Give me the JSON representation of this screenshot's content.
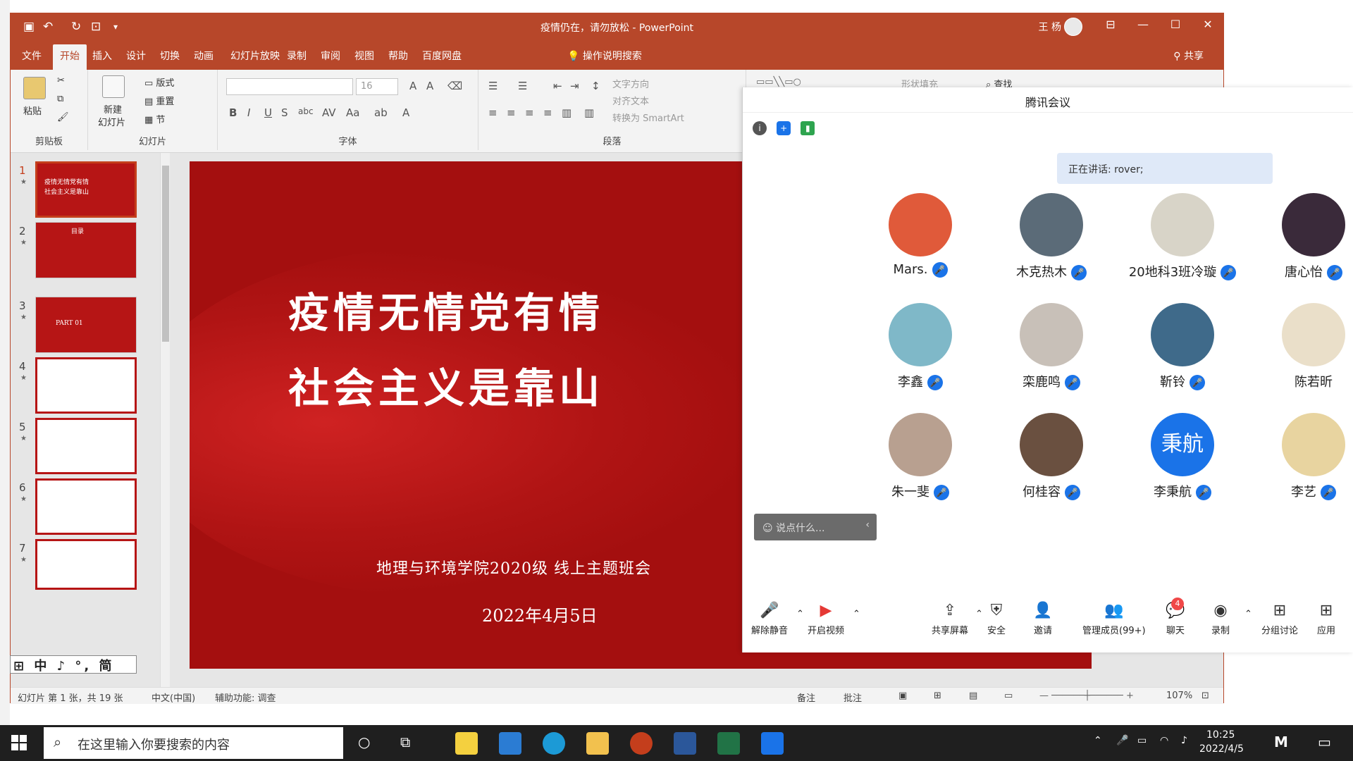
{
  "ppt": {
    "window_title": "疫情仍在，请勿放松  -  PowerPoint",
    "user_name": "王 杨",
    "menus": [
      "文件",
      "开始",
      "插入",
      "设计",
      "切换",
      "动画",
      "幻灯片放映",
      "录制",
      "审阅",
      "视图",
      "帮助",
      "百度网盘"
    ],
    "active_menu": "开始",
    "tell_me": "操作说明搜索",
    "share": "共享",
    "ribbon": {
      "paste": "粘贴",
      "clipboard": "剪贴板",
      "new_slide_1": "新建",
      "new_slide_2": "幻灯片",
      "layout": "版式",
      "reset": "重置",
      "section": "节",
      "slides_group": "幻灯片",
      "font_size": "16",
      "font_group": "字体",
      "paragraph_group": "段落",
      "text_direction": "文字方向",
      "align_text": "对齐文本",
      "smartart": "转换为 SmartArt",
      "shape_fill": "形状填充",
      "find": "查找"
    },
    "thumbnails": [
      {
        "num": "1",
        "text": "疫情无情党有情\n社会主义是靠山"
      },
      {
        "num": "2",
        "text": "目录"
      },
      {
        "num": "3",
        "text": "PART 01"
      },
      {
        "num": "4",
        "text": ""
      },
      {
        "num": "5",
        "text": ""
      },
      {
        "num": "6",
        "text": ""
      },
      {
        "num": "7",
        "text": ""
      }
    ],
    "slide": {
      "title1": "疫情无情党有情",
      "title2": "社会主义是靠山",
      "subtitle": "地理与环境学院2020级 线上主题班会",
      "date": "2022年4月5日"
    },
    "status": {
      "slide_count": "幻灯片 第 1 张，共 19 张",
      "language": "中文(中国)",
      "accessibility": "辅助功能: 调查",
      "notes": "备注",
      "comments": "批注",
      "zoom": "107%"
    },
    "ime": "中 ♪ °, 简"
  },
  "meeting": {
    "title": "腾讯会议",
    "speaking": "正在讲话: rover;",
    "participants": [
      {
        "name": "Mars.",
        "color": "#e05a3a",
        "mic": true
      },
      {
        "name": "木克热木",
        "color": "#5b6b78",
        "mic": true
      },
      {
        "name": "20地科3班冷璇",
        "color": "#d8d4c8",
        "mic": true
      },
      {
        "name": "唐心怡",
        "color": "#3a2a3a",
        "mic": true
      },
      {
        "name": "李鑫",
        "color": "#7fb8c8",
        "mic": true
      },
      {
        "name": "栾鹿鸣",
        "color": "#c8c0b8",
        "mic": true
      },
      {
        "name": "靳铃",
        "color": "#3f6a8a",
        "mic": true
      },
      {
        "name": "陈若昕",
        "color": "#eadfc9",
        "mic": false
      },
      {
        "name": "朱一斐",
        "color": "#b8a090",
        "mic": true
      },
      {
        "name": "何桂容",
        "color": "#6a5040",
        "mic": true
      },
      {
        "name": "李秉航",
        "color": "#1a73e8",
        "mic": true,
        "initials": "秉航"
      },
      {
        "name": "李艺",
        "color": "#e8d4a0",
        "mic": true
      }
    ],
    "chat_placeholder": "说点什么...",
    "toolbar": {
      "mute": "解除静音",
      "video": "开启视频",
      "share_screen": "共享屏幕",
      "security": "安全",
      "invite": "邀请",
      "members": "管理成员(99+)",
      "chat": "聊天",
      "chat_badge": "4",
      "record": "录制",
      "breakout": "分组讨论",
      "apps": "应用"
    }
  },
  "taskbar": {
    "search_placeholder": "在这里输入你要搜索的内容",
    "time": "10:25",
    "date": "2022/4/5"
  }
}
